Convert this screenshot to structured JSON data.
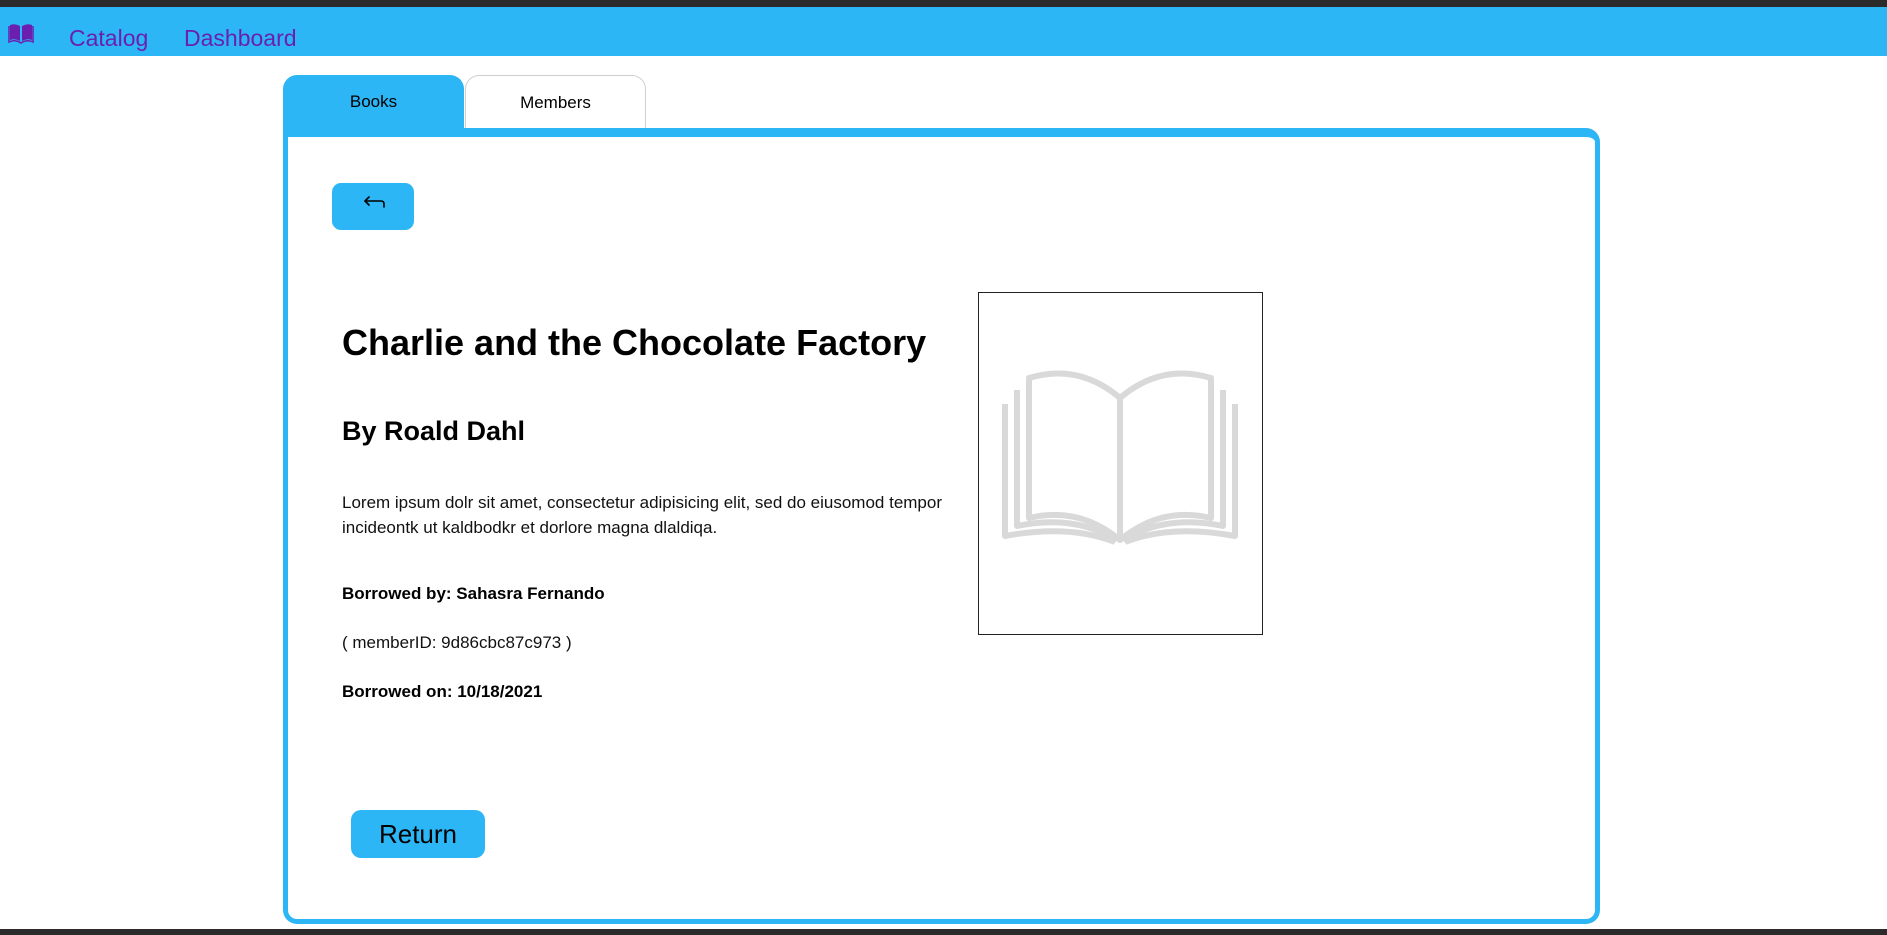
{
  "navbar": {
    "logo_icon": "book-open-icon",
    "links": [
      {
        "label": "Catalog"
      },
      {
        "label": "Dashboard"
      }
    ],
    "background_color": "#2db6f5",
    "link_color": "#6a1fb0"
  },
  "tabs": [
    {
      "label": "Books",
      "active": true
    },
    {
      "label": "Members",
      "active": false
    }
  ],
  "toolbar": {
    "back_icon": "back-arrow-icon"
  },
  "book": {
    "title": "Charlie and the Chocolate Factory",
    "author": "By Roald Dahl",
    "description": "Lorem ipsum dolr sit amet, consectetur adipisicing elit, sed do eiusomod tempor incideontk ut kaldbodkr et dorlore magna dlaldiqa.",
    "borrowed_by": "Borrowed by: Sahasra Fernando",
    "member_id": "( memberID: 9d86cbc87c973 )",
    "borrowed_on": "Borrowed on: 10/18/2021",
    "cover_icon": "open-book-placeholder-icon"
  },
  "actions": {
    "return_label": "Return"
  },
  "accent_color": "#2db6f5"
}
